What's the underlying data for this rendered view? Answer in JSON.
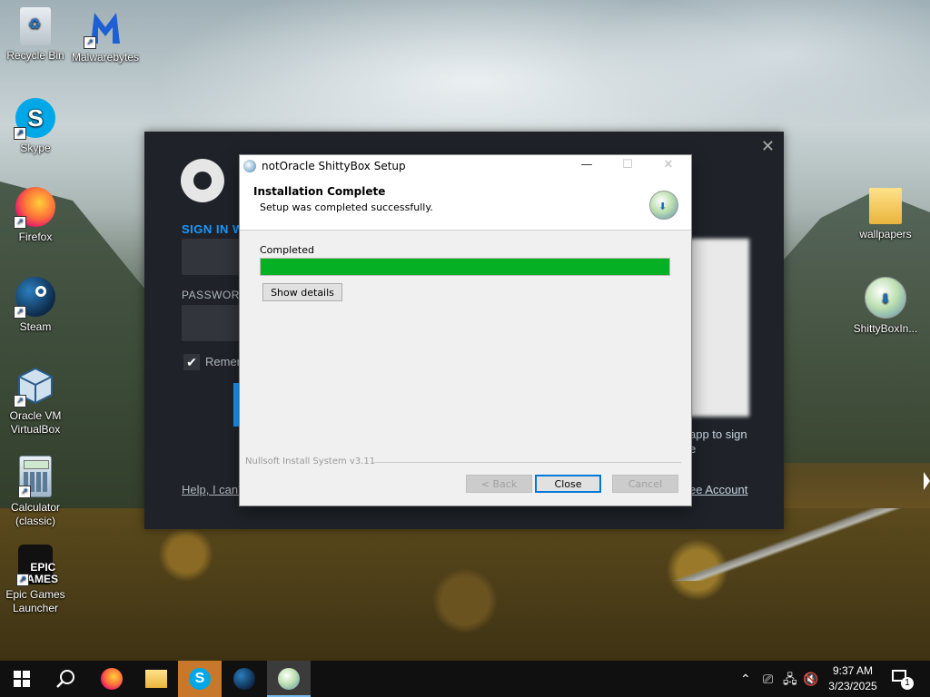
{
  "desktop": {
    "icons": [
      {
        "label": "Recycle Bin"
      },
      {
        "label": "Malwarebytes"
      },
      {
        "label": "Skype"
      },
      {
        "label": "Firefox"
      },
      {
        "label": "Steam"
      },
      {
        "label": "Oracle VM VirtualBox"
      },
      {
        "label": "Calculator (classic)"
      },
      {
        "label": "Epic Games Launcher"
      },
      {
        "label": "wallpapers"
      },
      {
        "label": "ShittyBoxIn..."
      }
    ],
    "epic_logo_text": "EPIC\nGAMES"
  },
  "steam_window": {
    "sign_in_label": "SIGN IN W",
    "password_label": "PASSWORD",
    "remember_label": "Remen",
    "help_link": "Help, I can't",
    "app_text": "app to sign\ne",
    "account_link": "ee Account",
    "close_glyph": "✕"
  },
  "dialog": {
    "title": "notOracle ShittyBox Setup",
    "minimize_glyph": "—",
    "maximize_glyph": "☐",
    "close_glyph": "✕",
    "header_title": "Installation Complete",
    "header_subtitle": "Setup was completed successfully.",
    "status_label": "Completed",
    "progress_fraction": 1.0,
    "show_details_label": "Show details",
    "footer_brand": "Nullsoft Install System v3.11",
    "back_label": "< Back",
    "close_label": "Close",
    "cancel_label": "Cancel"
  },
  "taskbar": {
    "clock_time": "9:37 AM",
    "clock_date": "3/23/2025",
    "notification_count": "1",
    "items": [
      "start",
      "search",
      "firefox",
      "file-explorer",
      "skype",
      "steam",
      "shittybox-setup"
    ]
  },
  "colors": {
    "progress_green": "#06b025",
    "steam_bg": "#1f2329",
    "steam_accent": "#1999ff",
    "taskbar_bg": "#101010"
  }
}
